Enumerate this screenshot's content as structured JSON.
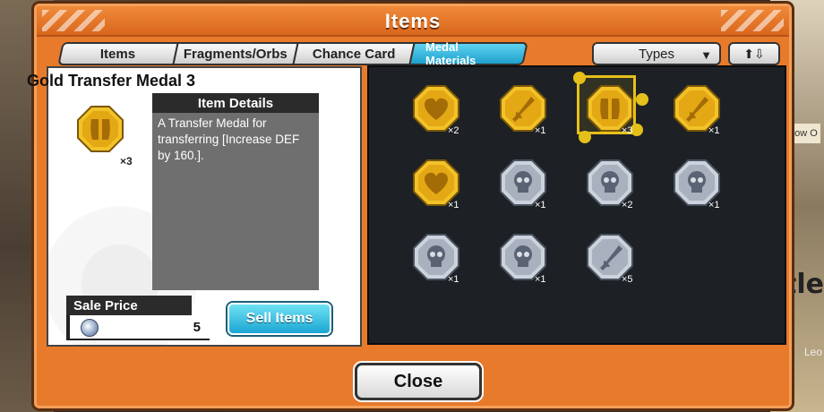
{
  "window": {
    "title": "Items"
  },
  "tabs": [
    {
      "label": "Items"
    },
    {
      "label": "Fragments/Orbs"
    },
    {
      "label": "Chance Card"
    },
    {
      "label": "Medal Materials",
      "active": true
    }
  ],
  "filters": {
    "types_label": "Types",
    "sort_icon": "sort-up-down-icon"
  },
  "detail": {
    "item_name": "Gold Transfer Medal 3",
    "medal_icon": "gold-armor-medal-icon",
    "count": "×3",
    "details_header": "Item Details",
    "description": "A Transfer Medal for transferring [Increase DEF by 160.].",
    "sale_label": "Sale Price",
    "sale_icon": "silver-coin-icon",
    "sale_value": "5",
    "sell_button": "Sell Items"
  },
  "grid": [
    {
      "icon": "gold-heart-medal-icon",
      "count": "×2",
      "tier": "gold"
    },
    {
      "icon": "gold-sword-medal-icon",
      "count": "×1",
      "tier": "gold"
    },
    {
      "icon": "gold-armor-medal-icon",
      "count": "×3",
      "tier": "gold",
      "selected": true
    },
    {
      "icon": "gold-sword-medal-icon",
      "count": "×1",
      "tier": "gold"
    },
    {
      "icon": "gold-heart-medal-icon",
      "count": "×1",
      "tier": "gold"
    },
    {
      "icon": "silver-skull-medal-icon",
      "count": "×1",
      "tier": "silver"
    },
    {
      "icon": "silver-skull-medal-icon",
      "count": "×2",
      "tier": "silver"
    },
    {
      "icon": "silver-skull-medal-icon",
      "count": "×1",
      "tier": "silver"
    },
    {
      "icon": "silver-skull-medal-icon",
      "count": "×1",
      "tier": "silver"
    },
    {
      "icon": "silver-skull-medal-icon",
      "count": "×1",
      "tier": "silver"
    },
    {
      "icon": "silver-sword-medal-icon",
      "count": "×5",
      "tier": "silver"
    }
  ],
  "footer": {
    "close_label": "Close"
  },
  "background": {
    "tag": "Now O",
    "big_text": "ttle",
    "name": "Leo"
  },
  "colors": {
    "frame": "#e77a2b",
    "active_tab": "#1ea0cc",
    "gold": "#e8b11c",
    "silver": "#b8c0cc",
    "select": "#e6c01a"
  }
}
